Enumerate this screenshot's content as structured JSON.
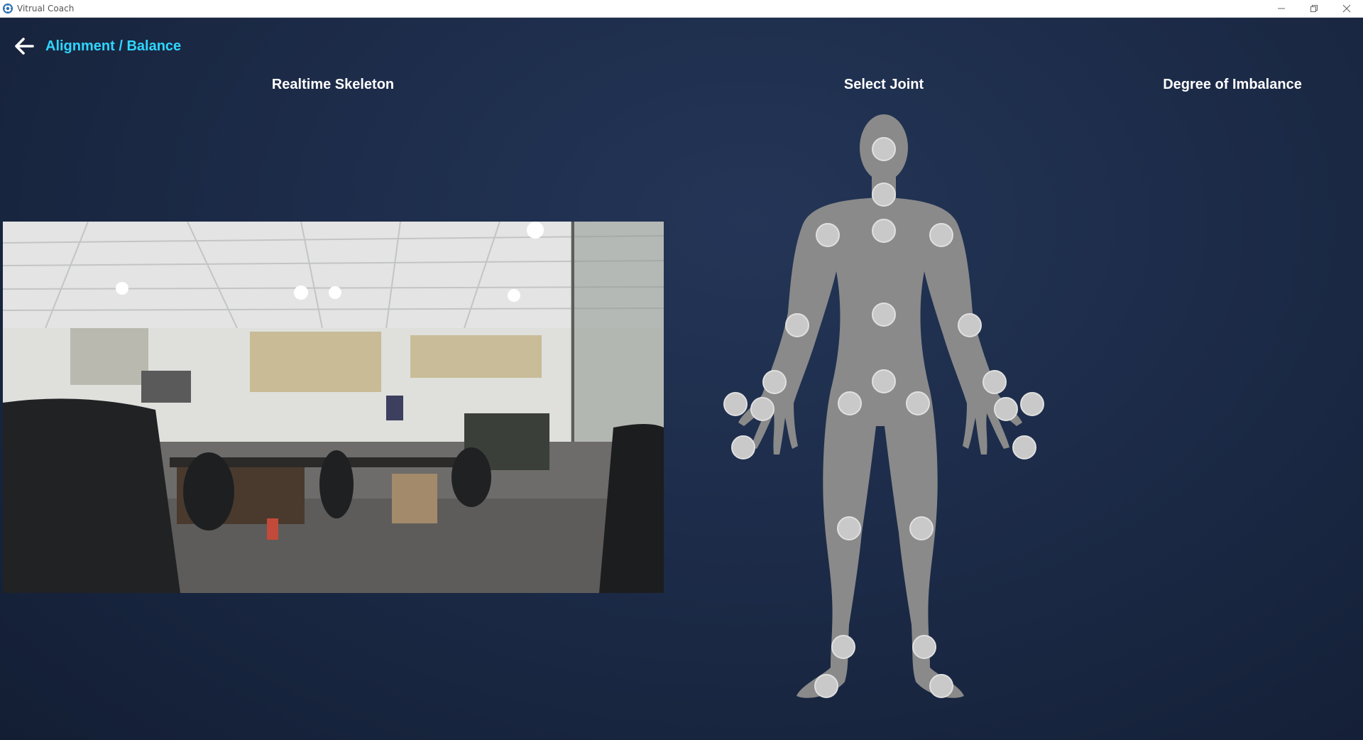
{
  "window": {
    "title": "Vitrual Coach",
    "minimize_icon": "minimize-icon",
    "restore_icon": "restore-icon",
    "close_icon": "close-icon"
  },
  "header": {
    "back_icon": "arrow-left-icon",
    "breadcrumb": "Alignment / Balance"
  },
  "columns": {
    "skeleton_title": "Realtime Skeleton",
    "select_joint_title": "Select Joint",
    "imbalance_title": "Degree of Imbalance"
  },
  "colors": {
    "accent": "#2fd6ff",
    "background": "#1c2b48",
    "body_fill": "#8a8a8a",
    "joint_fill": "#c9c9c9"
  }
}
